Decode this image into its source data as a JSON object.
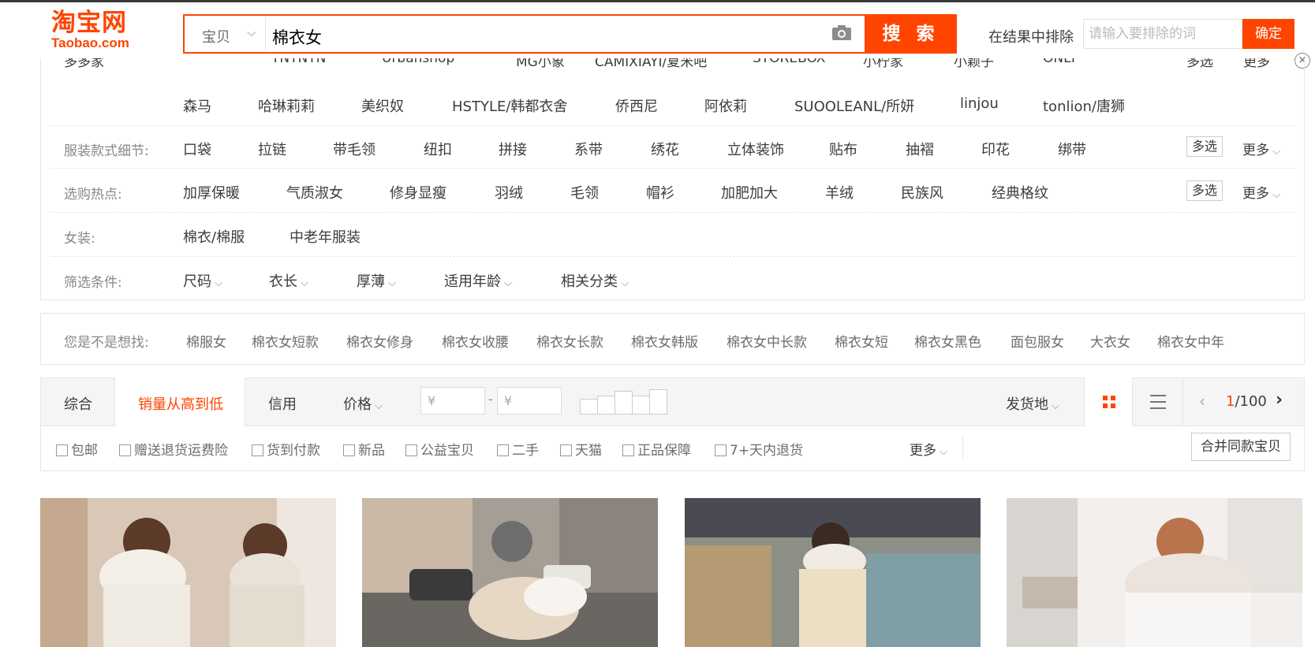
{
  "header": {
    "logo_cn": "淘宝网",
    "logo_en": "Taobao.com",
    "search_type": "宝贝",
    "search_query": "棉衣女",
    "search_button": "搜 索",
    "exclude_label": "在结果中排除",
    "exclude_placeholder": "请输入要排除的词",
    "exclude_button": "确定",
    "close_glyph": "×"
  },
  "filters": {
    "brand_row_cut": [
      "多多家",
      "TNTNTN",
      "Urbanshop",
      "MG小象",
      "CAMIXIAYI/夏米吧",
      "STOREBOX",
      "小柠家",
      "小颖子",
      "ONLY"
    ],
    "brand_more_cut": [
      "多选",
      "更多"
    ],
    "brand_row2": [
      "森马",
      "哈琳莉莉",
      "美织奴",
      "HSTYLE/韩都衣舍",
      "侨西尼",
      "阿依莉",
      "SUOOLEANL/所妍",
      "linjou",
      "tonlion/唐狮"
    ],
    "detail_label": "服装款式细节:",
    "detail_options": [
      "口袋",
      "拉链",
      "带毛领",
      "纽扣",
      "拼接",
      "系带",
      "绣花",
      "立体装饰",
      "贴布",
      "抽褶",
      "印花",
      "绑带"
    ],
    "hot_label": "选购热点:",
    "hot_options": [
      "加厚保暖",
      "气质淑女",
      "修身显瘦",
      "羽绒",
      "毛领",
      "帽衫",
      "加肥加大",
      "羊绒",
      "民族风",
      "经典格纹"
    ],
    "womens_label": "女装:",
    "womens_options": [
      "棉衣/棉服",
      "中老年服装"
    ],
    "cond_label": "筛选条件:",
    "cond_options": [
      "尺码",
      "衣长",
      "厚薄",
      "适用年龄",
      "相关分类"
    ],
    "multi_label": "多选",
    "more_label": "更多"
  },
  "suggestions": {
    "label": "您是不是想找:",
    "items": [
      "棉服女",
      "棉衣女短款",
      "棉衣女修身",
      "棉衣女收腰",
      "棉衣女长款",
      "棉衣女韩版",
      "棉衣女中长款",
      "棉衣女短",
      "棉衣女黑色",
      "面包服女",
      "大衣女",
      "棉衣女中年"
    ]
  },
  "sort": {
    "overall": "综合",
    "sales": "销量从高到低",
    "credit": "信用",
    "price": "价格",
    "price_from": "¥",
    "price_to": "¥",
    "price_dash": "-",
    "ship_from": "发货地",
    "page_current": "1",
    "page_total": "/100",
    "active_color": "#ff4400"
  },
  "checks": {
    "items": [
      "包邮",
      "赠送退货运费险",
      "货到付款",
      "新品",
      "公益宝贝",
      "二手",
      "天猫",
      "正品保障",
      "7+天内退货"
    ],
    "more": "更多",
    "merge": "合并同款宝贝"
  },
  "products": [
    {
      "name": "product-image-1"
    },
    {
      "name": "product-image-2"
    },
    {
      "name": "product-image-3"
    },
    {
      "name": "product-image-4"
    }
  ]
}
